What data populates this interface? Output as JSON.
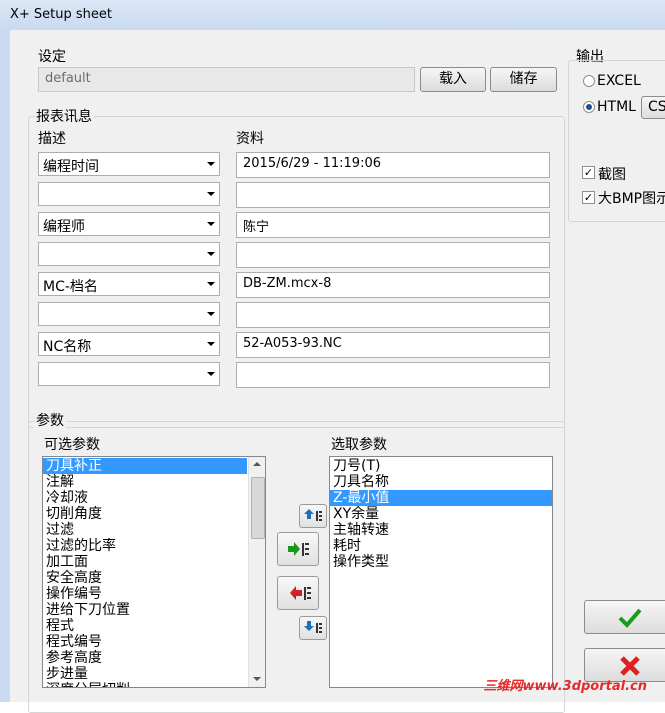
{
  "window": {
    "title": "X+ Setup sheet"
  },
  "settings": {
    "title": "设定",
    "name_value": "default",
    "load_label": "载入",
    "save_label": "储存"
  },
  "output": {
    "title": "输出",
    "excel_label": "EXCEL",
    "excel_selected": false,
    "html_label": "HTML",
    "html_selected": true,
    "cs_button_label": "CS",
    "screenshot_label": "截图",
    "screenshot_checked": true,
    "large_bmp_label": "大BMP图示",
    "large_bmp_checked": true
  },
  "report": {
    "title": "报表讯息",
    "col_description": "描述",
    "col_data": "资料",
    "rows": [
      {
        "description": "编程时间",
        "data": "2015/6/29 - 11:19:06"
      },
      {
        "description": "",
        "data": ""
      },
      {
        "description": "编程师",
        "data": "陈宁"
      },
      {
        "description": "",
        "data": ""
      },
      {
        "description": "MC-档名",
        "data": "DB-ZM.mcx-8"
      },
      {
        "description": "",
        "data": ""
      },
      {
        "description": "NC名称",
        "data": "52-A053-93.NC"
      },
      {
        "description": "",
        "data": ""
      }
    ]
  },
  "params": {
    "title": "参数",
    "available_title": "可选参数",
    "selected_title": "选取参数",
    "available": [
      "刀具补正",
      "注解",
      "冷却液",
      "切削角度",
      "过滤",
      "过滤的比率",
      "加工面",
      "安全高度",
      "操作编号",
      "进给下刀位置",
      "程式",
      "程式编号",
      "参考高度",
      "步进量",
      "深度分层切削"
    ],
    "available_selected_index": 0,
    "selected": [
      "刀号(T)",
      "刀具名称",
      "Z-最小值",
      "XY余量",
      "主轴转速",
      "耗时",
      "操作类型"
    ],
    "selected_selected_index": 2
  },
  "actions": {
    "ok_icon": "checkmark-icon",
    "cancel_icon": "cross-icon"
  },
  "watermark": "三维网www.3dportal.cn",
  "colors": {
    "selection": "#3399ff",
    "ok": "#1a9a1a",
    "cancel": "#e02020"
  }
}
